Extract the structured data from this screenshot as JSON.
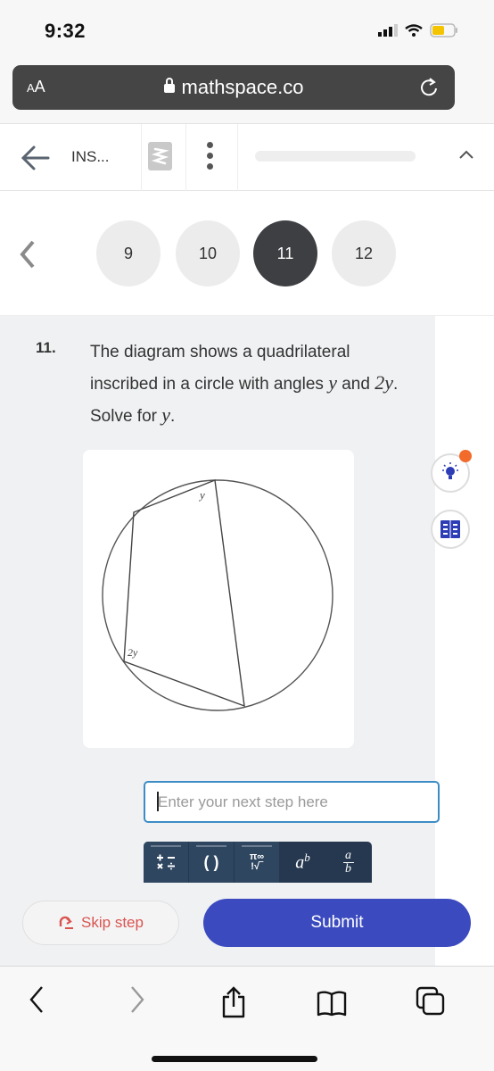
{
  "status_bar": {
    "time": "9:32",
    "battery_color": "#f5c400"
  },
  "browser": {
    "text_size_label": "AA",
    "url": "mathspace.co",
    "lock_icon": "lock-icon",
    "reload_icon": "reload-icon"
  },
  "app_nav": {
    "back_icon": "arrow-left-icon",
    "title": "INS...",
    "logo": "mathspace-logo",
    "more_icon": "vertical-dots-icon",
    "progress": 0,
    "collapse_icon": "chevron-up-icon"
  },
  "question_nav": {
    "prev_icon": "chevron-left-icon",
    "items": [
      {
        "label": "9",
        "active": false
      },
      {
        "label": "10",
        "active": false
      },
      {
        "label": "11",
        "active": true
      },
      {
        "label": "12",
        "active": false
      }
    ]
  },
  "question": {
    "number": "11.",
    "text_part1": "The diagram shows a quadrilateral inscribed in a circle with angles ",
    "var_y": "y",
    "text_part2": " and ",
    "var_2y": "2y",
    "text_part3": ". Solve for ",
    "var_y2": "y",
    "text_part4": ".",
    "diagram": {
      "angle_label_top": "y",
      "angle_label_bottom": "2y"
    }
  },
  "side_tools": {
    "hint_icon": "lightbulb-icon",
    "hint_badge_color": "#f26b2a",
    "book_icon": "book-icon"
  },
  "answer": {
    "placeholder": "Enter your next step here",
    "value": ""
  },
  "keypad": {
    "keys": [
      {
        "name": "operators",
        "label": "+− ×÷"
      },
      {
        "name": "brackets",
        "label": "( )"
      },
      {
        "name": "symbols",
        "label": "π∞ !√"
      },
      {
        "name": "power",
        "label": "a^b"
      },
      {
        "name": "fraction",
        "label": "a/b"
      }
    ]
  },
  "actions": {
    "skip_label": "Skip step",
    "submit_label": "Submit",
    "submit_color": "#3b4bbf",
    "skip_color": "#d9534f"
  },
  "bottom_bar": {
    "icons": [
      "back-icon",
      "forward-icon",
      "share-icon",
      "bookmarks-icon",
      "tabs-icon"
    ]
  }
}
